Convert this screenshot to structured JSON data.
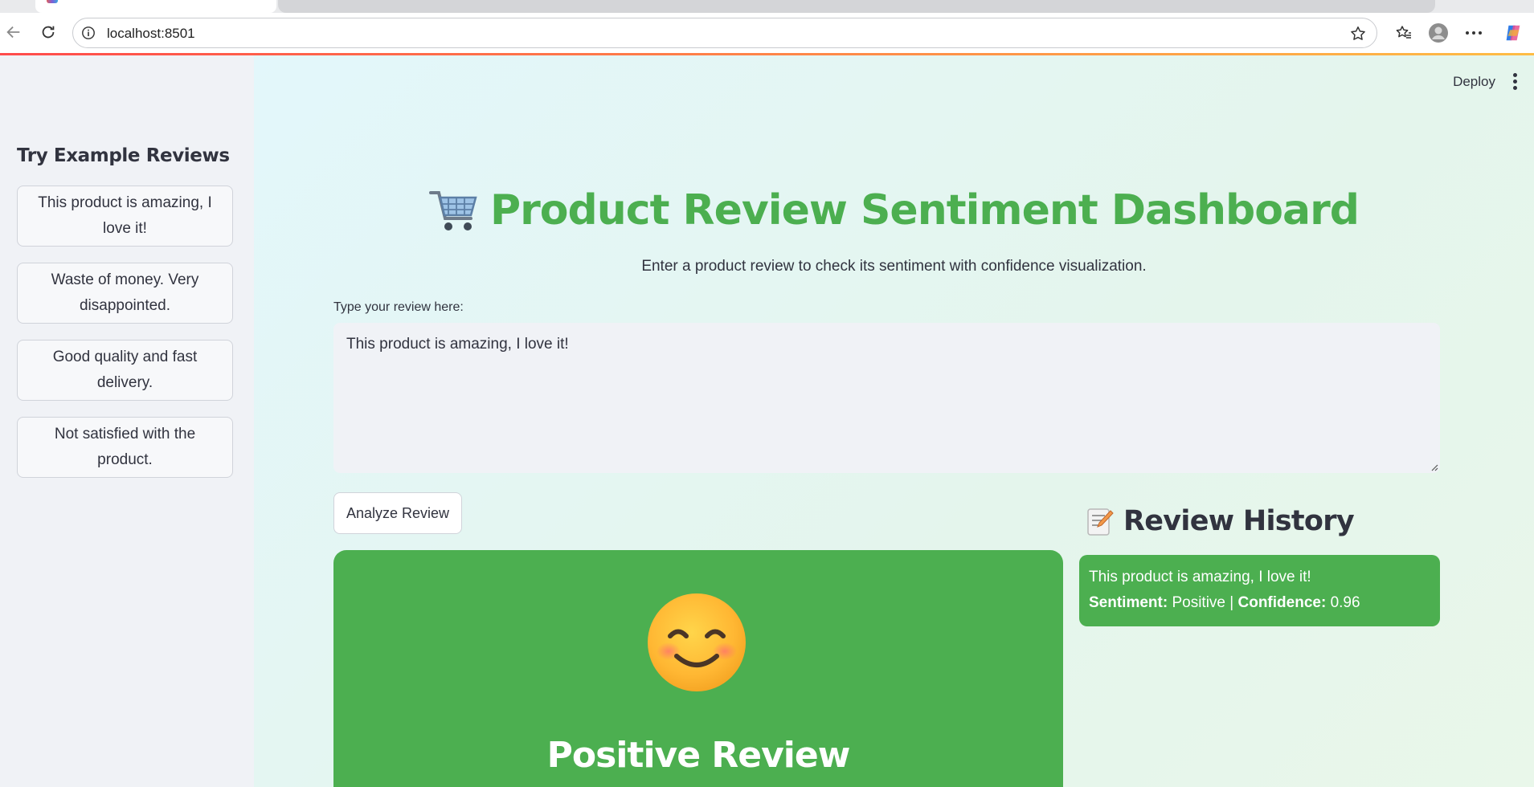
{
  "browser": {
    "url": "localhost:8501"
  },
  "app": {
    "deploy_label": "Deploy",
    "accent_color": "#4caf50"
  },
  "sidebar": {
    "title": "Try Example Reviews",
    "examples": [
      "This product is amazing, I love it!",
      "Waste of money. Very disappointed.",
      "Good quality and fast delivery.",
      "Not satisfied with the product."
    ]
  },
  "main": {
    "title": "Product Review Sentiment Dashboard",
    "title_icon": "shopping-cart-icon",
    "subtitle": "Enter a product review to check its sentiment with confidence visualization.",
    "input_label": "Type your review here:",
    "input_value": "This product is amazing, I love it!",
    "analyze_label": "Analyze Review",
    "result": {
      "emoji": "smiling-face-icon",
      "label": "Positive Review"
    }
  },
  "history": {
    "title": "Review History",
    "title_icon": "memo-icon",
    "items": [
      {
        "review": "This product is amazing, I love it!",
        "sentiment_label": "Sentiment:",
        "sentiment": "Positive",
        "separator": "|",
        "confidence_label": "Confidence:",
        "confidence": "0.96"
      }
    ]
  }
}
